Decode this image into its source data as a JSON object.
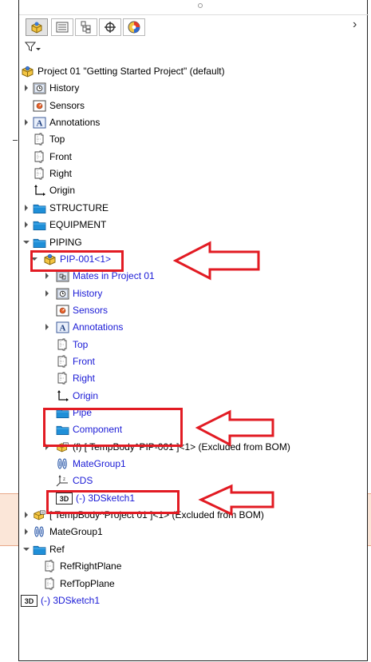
{
  "tabs": [
    {
      "name": "feature-manager",
      "icon": "feature-manager-icon"
    },
    {
      "name": "property-manager",
      "icon": "property-manager-icon"
    },
    {
      "name": "configuration-manager",
      "icon": "configuration-manager-icon"
    },
    {
      "name": "dimxpert-manager",
      "icon": "dimxpert-icon"
    },
    {
      "name": "display-manager",
      "icon": "display-manager-icon"
    }
  ],
  "colors": {
    "highlight": "#e21b23",
    "link": "#1a1ad6",
    "band": "#fbe6d8"
  },
  "tree": [
    {
      "label": "Project 01 \"Getting Started Project\"  (default)",
      "icon": "assembly-icon",
      "expander": "none",
      "level": 0,
      "blue": false
    },
    {
      "label": "History",
      "icon": "history-icon",
      "expander": "collapsed",
      "level": 1,
      "blue": false
    },
    {
      "label": "Sensors",
      "icon": "sensors-icon",
      "expander": "none",
      "level": 1,
      "blue": false
    },
    {
      "label": "Annotations",
      "icon": "annotations-icon",
      "expander": "collapsed",
      "level": 1,
      "blue": false
    },
    {
      "label": "Top",
      "icon": "plane-icon",
      "expander": "none",
      "level": 1,
      "blue": false
    },
    {
      "label": "Front",
      "icon": "plane-icon",
      "expander": "none",
      "level": 1,
      "blue": false
    },
    {
      "label": "Right",
      "icon": "plane-icon",
      "expander": "none",
      "level": 1,
      "blue": false
    },
    {
      "label": "Origin",
      "icon": "origin-icon",
      "expander": "none",
      "level": 1,
      "blue": false
    },
    {
      "label": "STRUCTURE",
      "icon": "folder-icon",
      "expander": "collapsed",
      "level": 1,
      "blue": false
    },
    {
      "label": "EQUIPMENT",
      "icon": "folder-icon",
      "expander": "collapsed",
      "level": 1,
      "blue": false
    },
    {
      "label": "PIPING",
      "icon": "folder-icon",
      "expander": "expanded",
      "level": 1,
      "blue": false
    },
    {
      "label": "PIP-001<1>",
      "icon": "assembly-icon",
      "expander": "expanded",
      "level": 2,
      "blue": true
    },
    {
      "label": "Mates in Project 01",
      "icon": "mates-icon",
      "expander": "collapsed",
      "level": 3,
      "blue": true
    },
    {
      "label": "History",
      "icon": "history-icon",
      "expander": "collapsed",
      "level": 3,
      "blue": true
    },
    {
      "label": "Sensors",
      "icon": "sensors-icon",
      "expander": "none",
      "level": 3,
      "blue": true
    },
    {
      "label": "Annotations",
      "icon": "annotations-icon",
      "expander": "collapsed",
      "level": 3,
      "blue": true
    },
    {
      "label": "Top",
      "icon": "plane-icon",
      "expander": "none",
      "level": 3,
      "blue": true
    },
    {
      "label": "Front",
      "icon": "plane-icon",
      "expander": "none",
      "level": 3,
      "blue": true
    },
    {
      "label": "Right",
      "icon": "plane-icon",
      "expander": "none",
      "level": 3,
      "blue": true
    },
    {
      "label": "Origin",
      "icon": "origin-icon",
      "expander": "none",
      "level": 3,
      "blue": true
    },
    {
      "label": "Pipe",
      "icon": "folder-icon",
      "expander": "none",
      "level": 3,
      "blue": true
    },
    {
      "label": "Component",
      "icon": "folder-icon",
      "expander": "none",
      "level": 3,
      "blue": true
    },
    {
      "label": "(f) [ TempBody^PIP-001 ]<1> (Excluded from BOM)",
      "icon": "temp-body-part-icon",
      "expander": "collapsed",
      "level": 3,
      "blue": false
    },
    {
      "label": "MateGroup1",
      "icon": "mategroup-icon",
      "expander": "none",
      "level": 3,
      "blue": true
    },
    {
      "label": "CDS",
      "icon": "coordinate-system-icon",
      "expander": "none",
      "level": 3,
      "blue": true
    },
    {
      "label": "(-) 3DSketch1",
      "icon": "3d-sketch-icon",
      "expander": "none",
      "level": 3,
      "blue": true
    },
    {
      "label": "[ TempBody^Project 01 ]<1> (Excluded from BOM)",
      "icon": "temp-body-part-icon",
      "expander": "collapsed",
      "level": 1,
      "blue": false
    },
    {
      "label": "MateGroup1",
      "icon": "mategroup-icon",
      "expander": "collapsed",
      "level": 1,
      "blue": false
    },
    {
      "label": "Ref",
      "icon": "folder-icon",
      "expander": "expanded",
      "level": 1,
      "blue": false
    },
    {
      "label": "RefRightPlane",
      "icon": "plane-icon",
      "expander": "none",
      "level": 2,
      "blue": false
    },
    {
      "label": "RefTopPlane",
      "icon": "plane-icon",
      "expander": "none",
      "level": 2,
      "blue": false
    },
    {
      "label": "(-) 3DSketch1",
      "icon": "3d-sketch-icon",
      "expander": "none",
      "level": 0,
      "blue": true
    }
  ]
}
